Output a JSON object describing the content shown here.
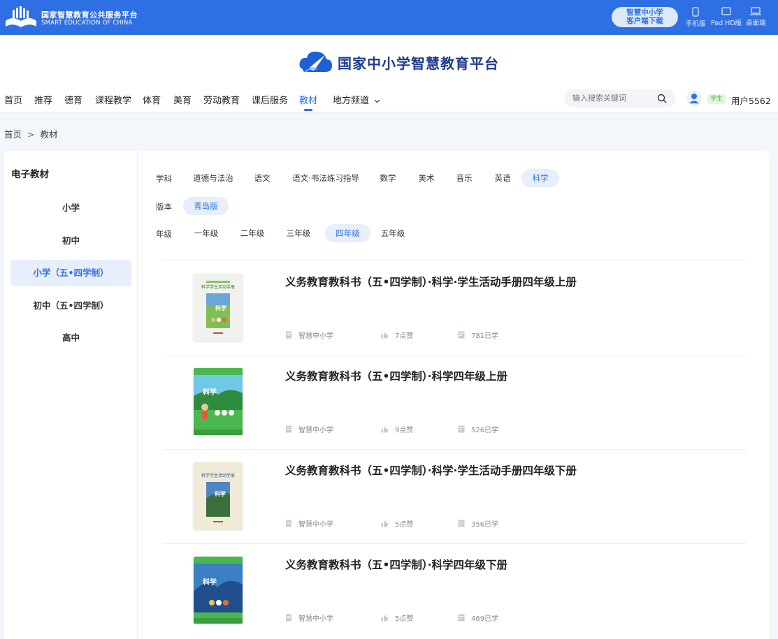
{
  "topbar": {
    "title": "国家智慧教育公共服务平台",
    "subtitle": "SMART EDUCATION OF CHINA",
    "download_line1": "智慧中小学",
    "download_line2": "客户端下载",
    "devices": [
      "手机版",
      "Pad HD版",
      "桌面端"
    ]
  },
  "header": {
    "brand": "国家中小学智慧教育平台",
    "nav": [
      "首页",
      "推荐",
      "德育",
      "课程教学",
      "体育",
      "美育",
      "劳动教育",
      "课后服务",
      "教材",
      "地方频道"
    ],
    "active_nav": "教材",
    "search_placeholder": "输入搜索关键词",
    "role_badge": "学生",
    "user_name": "用户5562"
  },
  "breadcrumb": [
    "首页",
    "教材"
  ],
  "sidebar": {
    "title": "电子教材",
    "items": [
      "小学",
      "初中",
      "小学（五•四学制）",
      "初中（五•四学制）",
      "高中"
    ],
    "active_index": 2
  },
  "filters": {
    "subject_label": "学科",
    "subjects": [
      "道德与法治",
      "语文",
      "语文·书法练习指导",
      "数学",
      "美术",
      "音乐",
      "英语",
      "科学"
    ],
    "active_subject": "科学",
    "edition_label": "版本",
    "editions": [
      "青岛版"
    ],
    "active_edition": "青岛版",
    "grade_label": "年级",
    "grades": [
      "一年级",
      "二年级",
      "三年级",
      "四年级",
      "五年级"
    ],
    "active_grade": "四年级"
  },
  "books": [
    {
      "title": "义务教育教科书（五•四学制）·科学·学生活动手册四年级上册",
      "publisher": "智慧中小学",
      "likes": "7点赞",
      "learners": "781已学",
      "cover": "workbook"
    },
    {
      "title": "义务教育教科书（五•四学制）·科学四年级上册",
      "publisher": "智慧中小学",
      "likes": "9点赞",
      "learners": "526已学",
      "cover": "green"
    },
    {
      "title": "义务教育教科书（五•四学制）·科学·学生活动手册四年级下册",
      "publisher": "智慧中小学",
      "likes": "5点赞",
      "learners": "356已学",
      "cover": "workbook2"
    },
    {
      "title": "义务教育教科书（五•四学制）·科学四年级下册",
      "publisher": "智慧中小学",
      "likes": "5点赞",
      "learners": "469已学",
      "cover": "blue"
    }
  ],
  "colors": {
    "primary": "#2f6fe4",
    "active_bg": "#e7eefc",
    "badge_green": "#4dbb3c"
  }
}
